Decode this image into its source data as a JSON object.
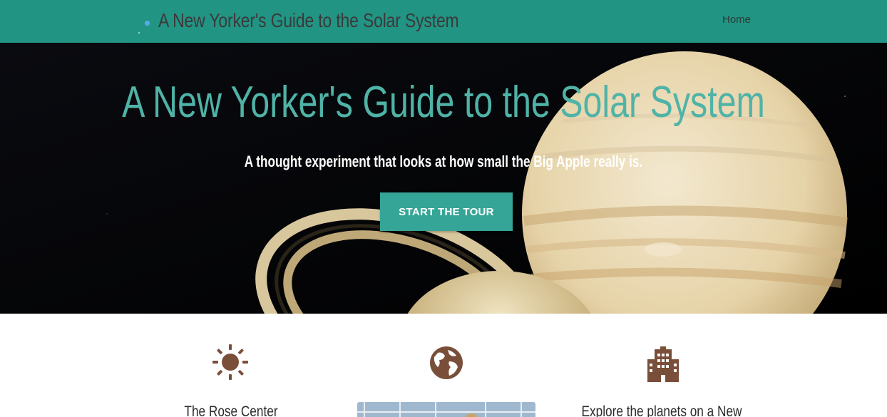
{
  "nav": {
    "brand_title": "A New Yorker's Guide to the Solar System",
    "home_label": "Home"
  },
  "hero": {
    "heading": "A New Yorker's Guide to the Solar System",
    "subheading": "A thought experiment that looks at how small the Big Apple really is.",
    "cta_label": "START THE TOUR"
  },
  "features": {
    "items": [
      {
        "icon": "sun-icon",
        "title": "The Rose Center"
      },
      {
        "icon": "globe-icon",
        "title": ""
      },
      {
        "icon": "city-buildings-icon",
        "title": "Explore the planets on a New"
      }
    ]
  },
  "colors": {
    "nav_bg": "#229484",
    "heading_teal": "#4fb3a7",
    "button_bg": "#35a597",
    "icon_brown": "#7a4f3a"
  }
}
